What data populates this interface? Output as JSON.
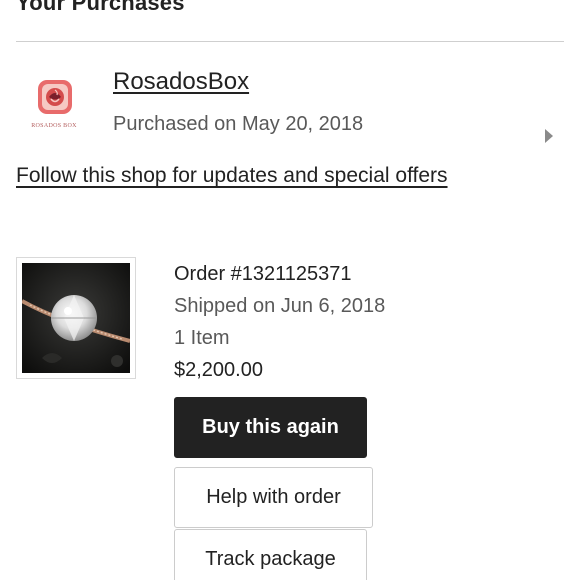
{
  "header": {
    "title": "Your Purchases"
  },
  "shop": {
    "name": "RosadosBox",
    "logo_text": "ROSADOS BOX",
    "purchased_label": "Purchased on May 20, 2018",
    "follow_label": "Follow this shop for updates and special offers",
    "logo_icon": "rose-logo-icon",
    "expand_icon": "chevron-right-icon"
  },
  "order": {
    "number": "Order #1321125371",
    "shipped": "Shipped on Jun 6, 2018",
    "item_count": "1 Item",
    "total": "$2,200.00",
    "thumbnail_icon": "diamond-ring-image"
  },
  "actions": {
    "buy_again": "Buy this again",
    "help": "Help with order",
    "track": "Track package"
  },
  "colors": {
    "primary_button": "#222222",
    "text": "#222222",
    "muted_text": "#595959",
    "logo_accent": "#d65a5a"
  }
}
